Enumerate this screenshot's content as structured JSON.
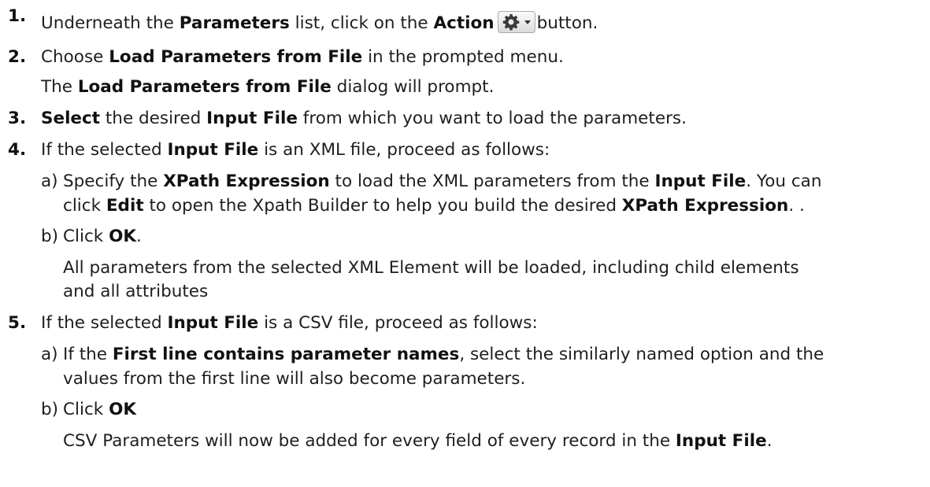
{
  "steps": [
    {
      "number": "1.",
      "parts": {
        "a": "Underneath the ",
        "b": "Parameters",
        "c": " list, click on the ",
        "d": "Action",
        "e": "button."
      },
      "button_icon": "gear-icon"
    },
    {
      "number": "2.",
      "parts": {
        "a": "Choose ",
        "b": "Load Parameters from File",
        "c": " in the prompted menu."
      },
      "result": {
        "a": "The ",
        "b": "Load Parameters from File",
        "c": " dialog will prompt."
      }
    },
    {
      "number": "3.",
      "parts": {
        "a": "Select",
        "b": " the desired ",
        "c": "Input File",
        "d": " from which you want to load the parameters."
      }
    },
    {
      "number": "4.",
      "parts": {
        "a": "If the selected ",
        "b": "Input File",
        "c": " is an XML file, proceed as follows:"
      },
      "sub": [
        {
          "letter": "a)",
          "line1": {
            "a": "Specify the ",
            "b": "XPath Expression",
            "c": " to load the XML parameters from the ",
            "d": "Input File",
            "e": ". You can"
          },
          "line2": {
            "a": "click ",
            "b": "Edit",
            "c": " to open the Xpath Builder to help you build the desired ",
            "d": "XPath Expression",
            "e": ". ."
          }
        },
        {
          "letter": "b)",
          "line1": {
            "a": "Click ",
            "b": "OK",
            "c": "."
          },
          "result1": "All parameters from the selected XML Element will be loaded, including child elements",
          "result2": "and all attributes"
        }
      ]
    },
    {
      "number": "5.",
      "parts": {
        "a": "If the selected ",
        "b": "Input File",
        "c": " is a CSV file, proceed as follows:"
      },
      "sub": [
        {
          "letter": "a)",
          "line1": {
            "a": "If the ",
            "b": "First line contains parameter names",
            "c": ", select the similarly named option and the"
          },
          "line2": "values from the first line will also become parameters."
        },
        {
          "letter": "b)",
          "line1": {
            "a": "Click ",
            "b": "OK"
          },
          "result": {
            "a": "CSV Parameters will now be added for every field of every record in the ",
            "b": "Input File",
            "c": "."
          }
        }
      ]
    }
  ]
}
